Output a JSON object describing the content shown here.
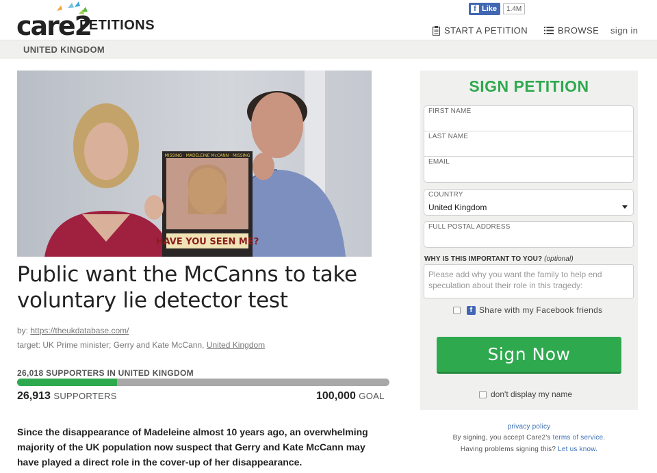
{
  "header": {
    "logo_text": "care2",
    "logo_sub": "PETITIONS",
    "fb_like_label": "Like",
    "fb_like_count": "1.4M",
    "nav": {
      "start": "START A PETITION",
      "browse": "BROWSE",
      "signin": "sign in"
    },
    "region": "UNITED KINGDOM"
  },
  "petition": {
    "hero_icon": "photo-icon",
    "title": "Public want the McCanns to take voluntary lie detector test",
    "by_label": "by:",
    "by_link": "https://theukdatabase.com/",
    "target_label": "target: UK Prime minister; Gerry and Kate McCann,",
    "target_link": "United Kingdom",
    "country_supporters": "26,018 SUPPORTERS IN UNITED KINGDOM",
    "progress": 0.269,
    "supporters_count": "26,913",
    "supporters_word": "SUPPORTERS",
    "goal_count": "100,000",
    "goal_word": "GOAL",
    "body": "Since the disappearance of Madeleine almost 10 years ago, an overwhelming majority of the UK population now suspect that Gerry and Kate McCann may have played a direct role in the cover-up of her disappearance."
  },
  "form": {
    "title": "SIGN PETITION",
    "first_name": "FIRST NAME",
    "last_name": "LAST NAME",
    "email": "EMAIL",
    "country_label": "COUNTRY",
    "country_value": "United Kingdom",
    "address": "FULL POSTAL ADDRESS",
    "why_label": "WHY IS THIS IMPORTANT TO YOU?",
    "why_optional": "(optional)",
    "why_placeholder": "Please add why you want the family to help end speculation about their role in this tragedy:",
    "share_label": "Share with my Facebook friends",
    "submit": "Sign Now",
    "dont_display": "don't display my name"
  },
  "footer": {
    "privacy": "privacy policy",
    "by_signing": "By signing, you accept Care2's",
    "terms": "terms of service.",
    "problems": "Having problems signing this?",
    "let_us_know": "Let us know."
  }
}
